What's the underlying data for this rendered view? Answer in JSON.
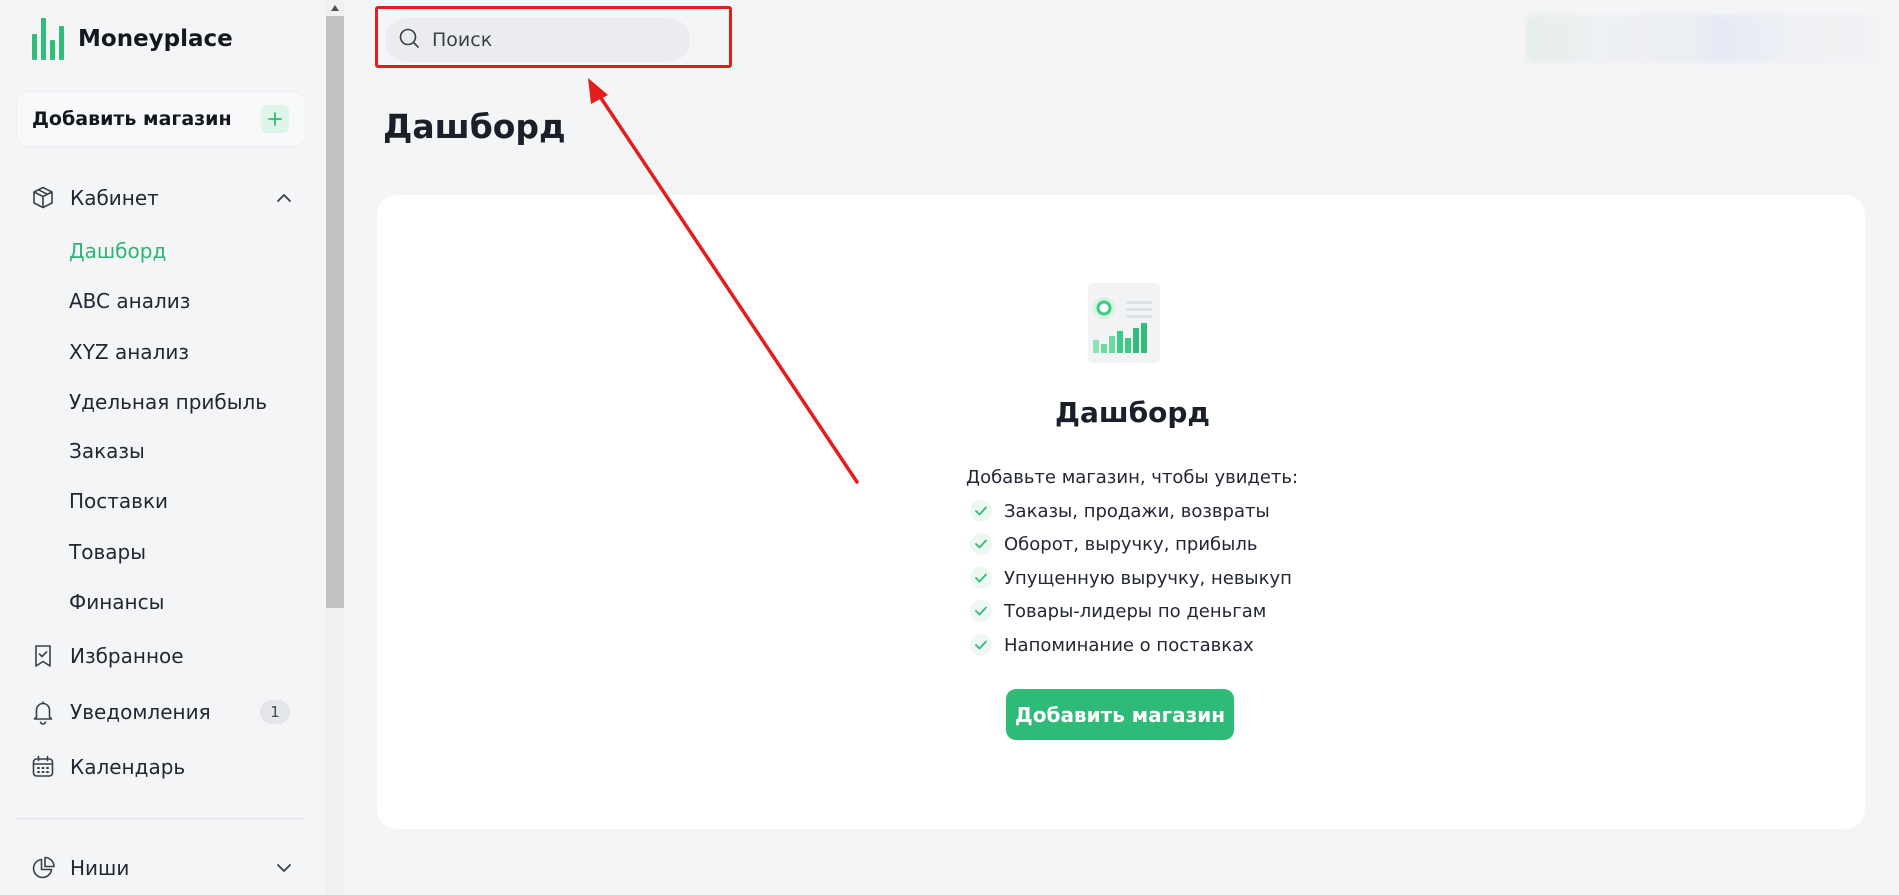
{
  "app": {
    "name": "Moneyplace"
  },
  "sidebar": {
    "add_store_label": "Добавить магазин",
    "cabinet": {
      "label": "Кабинет",
      "items": [
        {
          "label": "Дашборд",
          "active": true
        },
        {
          "label": "ABC анализ"
        },
        {
          "label": "XYZ анализ"
        },
        {
          "label": "Удельная прибыль"
        },
        {
          "label": "Заказы"
        },
        {
          "label": "Поставки"
        },
        {
          "label": "Товары"
        },
        {
          "label": "Финансы"
        }
      ]
    },
    "favorites_label": "Избранное",
    "notifications": {
      "label": "Уведомления",
      "count": "1"
    },
    "calendar_label": "Календарь",
    "niches_label": "Ниши"
  },
  "search": {
    "placeholder": "Поиск"
  },
  "page": {
    "title": "Дашборд"
  },
  "card": {
    "title": "Дашборд",
    "intro": "Добавьте магазин, чтобы увидеть:",
    "features": [
      "Заказы, продажи, возвраты",
      "Оборот, выручку, прибыль",
      "Упущенную выручку, невыкуп",
      "Товары-лидеры по деньгам",
      "Напоминание о поставках"
    ],
    "cta_label": "Добавить магазин"
  },
  "colors": {
    "accent": "#2ebb78",
    "active_nav": "#2fb574",
    "annotation": "#e31c1c",
    "background": "#f4f5f7",
    "card": "#ffffff"
  },
  "icons": {
    "logo": "bars-logo-icon",
    "add": "plus-icon",
    "cabinet": "box-icon",
    "favorites": "bookmark-icon",
    "notifications": "bell-icon",
    "calendar": "calendar-icon",
    "niches": "pie-chart-icon",
    "search": "search-icon",
    "check": "check-icon"
  }
}
